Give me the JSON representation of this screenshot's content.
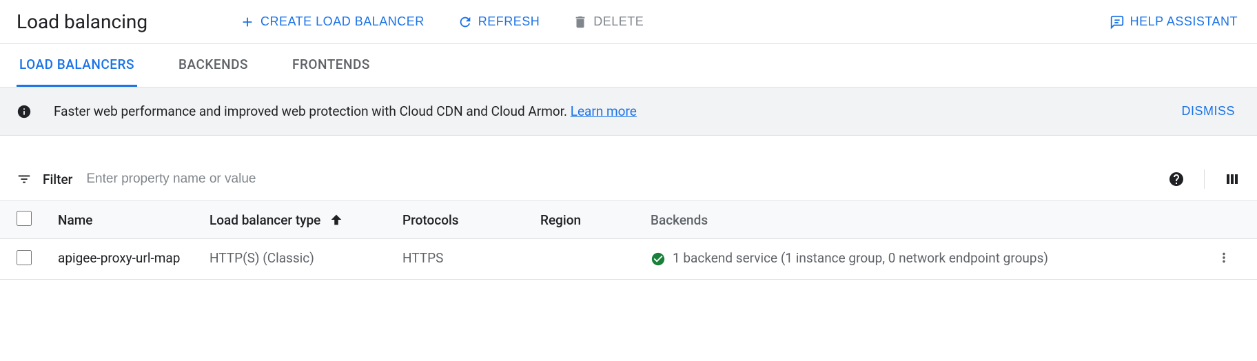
{
  "header": {
    "title": "Load balancing",
    "actions": {
      "create": "CREATE LOAD BALANCER",
      "refresh": "REFRESH",
      "delete": "DELETE",
      "help": "HELP ASSISTANT"
    }
  },
  "tabs": {
    "load_balancers": "LOAD BALANCERS",
    "backends": "BACKENDS",
    "frontends": "FRONTENDS"
  },
  "banner": {
    "text": "Faster web performance and improved web protection with Cloud CDN and Cloud Armor. ",
    "link": "Learn more",
    "dismiss": "DISMISS"
  },
  "filter": {
    "label": "Filter",
    "placeholder": "Enter property name or value"
  },
  "table": {
    "columns": {
      "name": "Name",
      "type": "Load balancer type",
      "protocols": "Protocols",
      "region": "Region",
      "backends": "Backends"
    },
    "rows": [
      {
        "name": "apigee-proxy-url-map",
        "type": "HTTP(S) (Classic)",
        "protocols": "HTTPS",
        "region": "",
        "backends": "1 backend service (1 instance group, 0 network endpoint groups)"
      }
    ]
  }
}
